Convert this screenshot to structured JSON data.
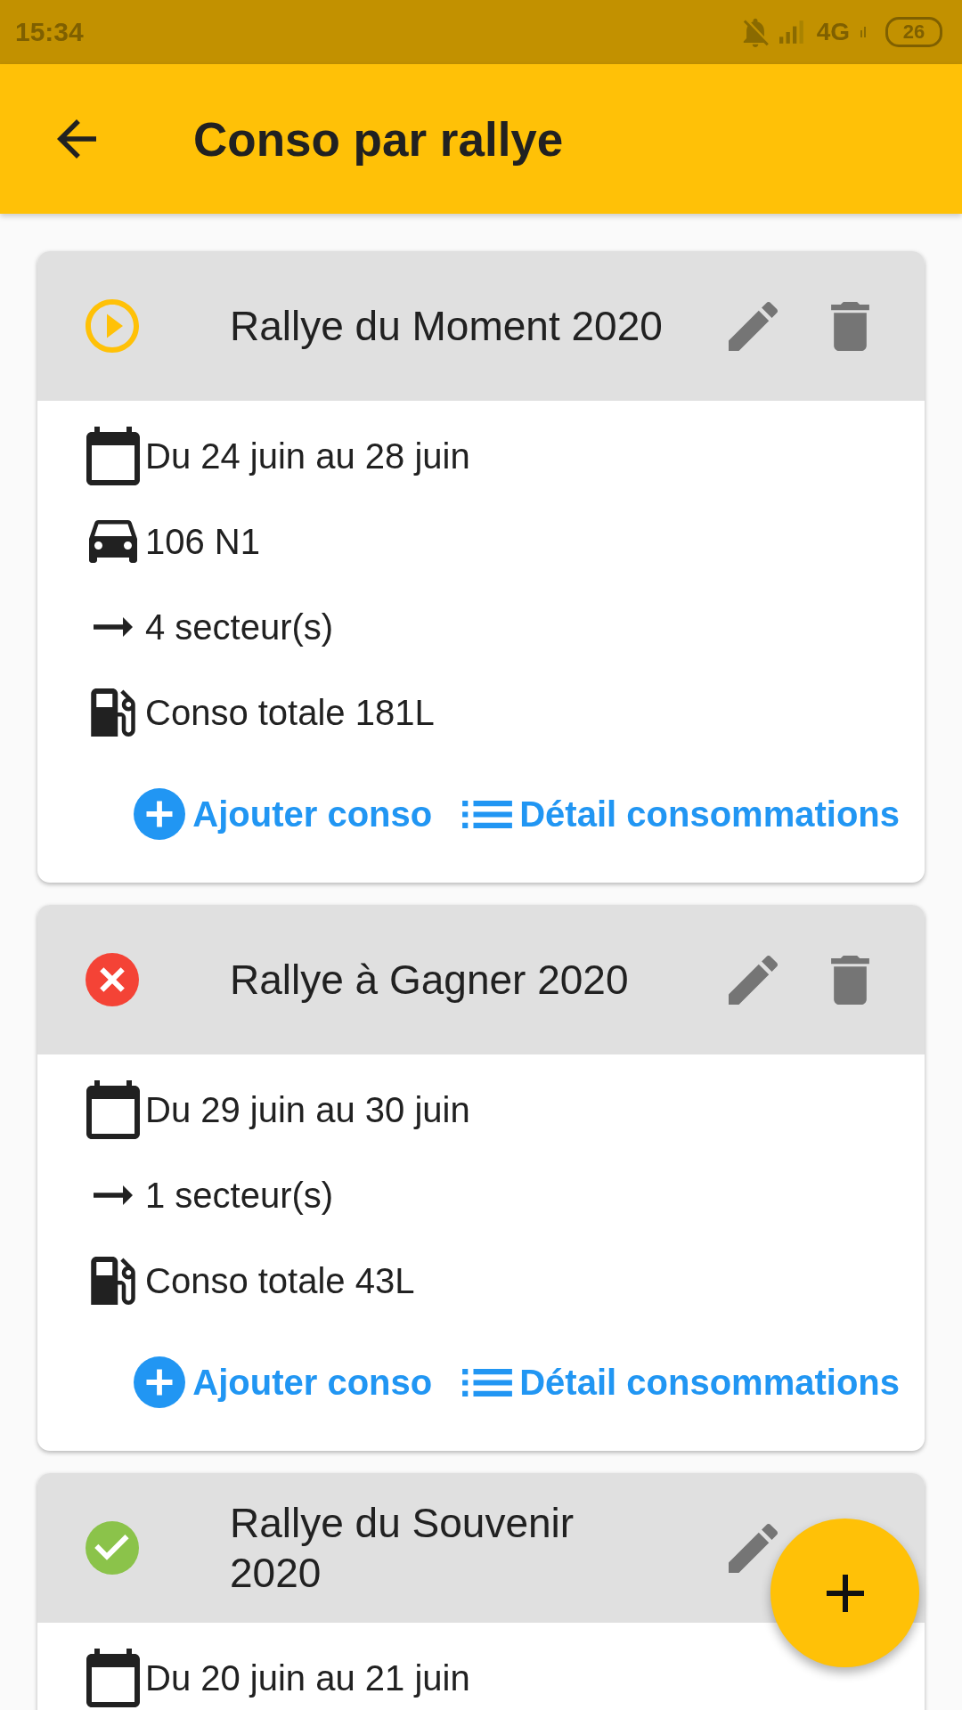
{
  "status_bar": {
    "time": "15:34",
    "network": "4G",
    "battery": "26"
  },
  "app_bar": {
    "title": "Conso par rallye"
  },
  "rallies": [
    {
      "kind": "in_progress",
      "title": "Rallye du Moment 2020",
      "header_actions": [
        {
          "kind": "edit"
        },
        {
          "kind": "delete"
        }
      ],
      "details": [
        {
          "kind": "dates",
          "text": "Du 24 juin au 28 juin"
        },
        {
          "kind": "car",
          "text": "106 N1"
        },
        {
          "kind": "sectors",
          "text": "4 secteur(s)"
        },
        {
          "kind": "fuel",
          "text": "Conso totale 181L"
        }
      ],
      "actions": [
        {
          "kind": "add",
          "label": "Ajouter conso"
        },
        {
          "kind": "details",
          "label": "Détail consommations"
        }
      ]
    },
    {
      "kind": "cancelled",
      "title": "Rallye à Gagner 2020",
      "header_actions": [
        {
          "kind": "edit"
        },
        {
          "kind": "delete"
        }
      ],
      "details": [
        {
          "kind": "dates",
          "text": "Du 29 juin au 30 juin"
        },
        {
          "kind": "sectors",
          "text": "1 secteur(s)"
        },
        {
          "kind": "fuel",
          "text": "Conso totale 43L"
        }
      ],
      "actions": [
        {
          "kind": "add",
          "label": "Ajouter conso"
        },
        {
          "kind": "details",
          "label": "Détail consommations"
        }
      ]
    },
    {
      "kind": "done",
      "title": "Rallye du Souvenir 2020",
      "header_actions": [
        {
          "kind": "edit"
        }
      ],
      "details": [
        {
          "kind": "dates",
          "text": "Du 20 juin au 21 juin"
        }
      ]
    }
  ]
}
